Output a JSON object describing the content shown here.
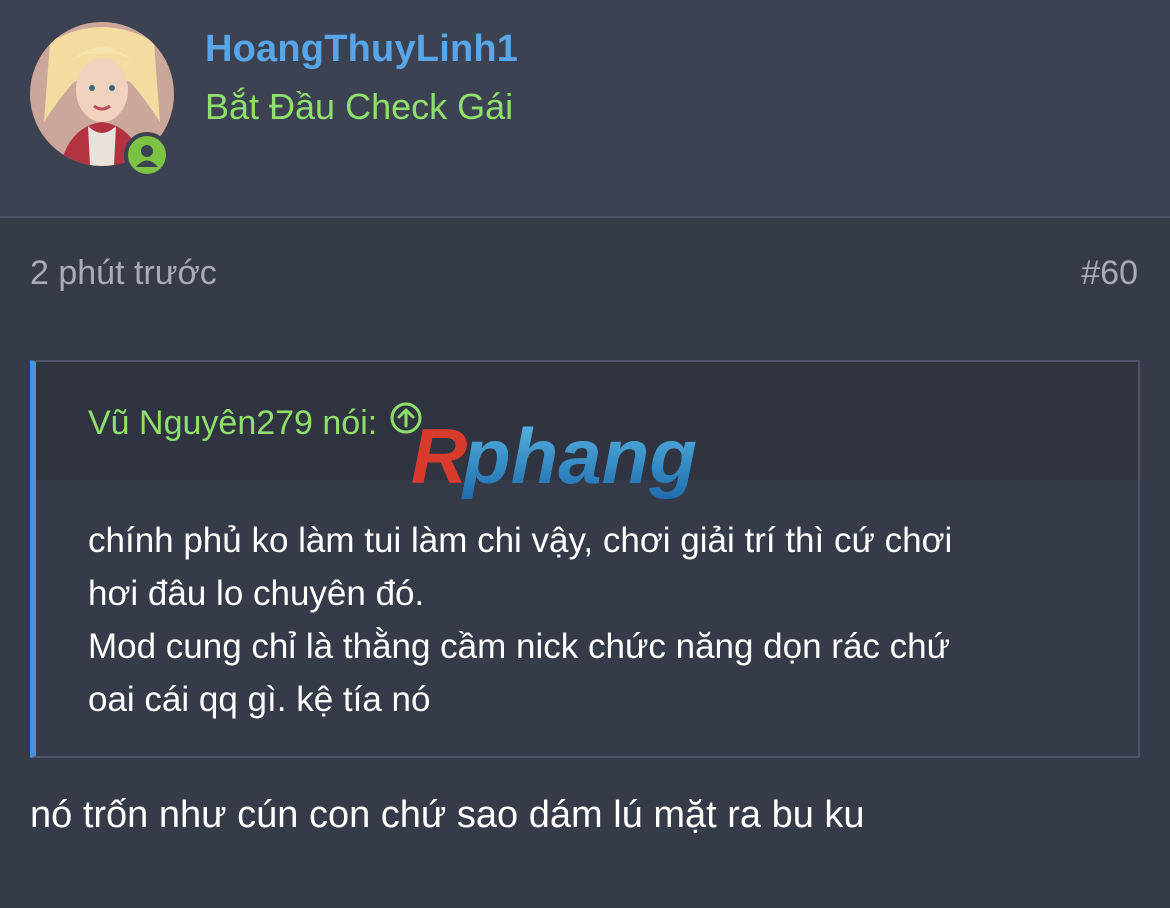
{
  "user": {
    "name": "HoangThuyLinh1",
    "title": "Bắt Đầu Check Gái"
  },
  "post": {
    "time": "2 phút trước",
    "number": "#60",
    "reply": "nó trốn như cún con chứ sao dám lú mặt ra bu ku"
  },
  "quote": {
    "author": "Vũ Nguyên279 nói:",
    "lines": [
      "chính phủ ko làm tui làm chi vậy, chơi giải trí thì cứ chơi",
      "hơi đâu lo chuyên đó.",
      "Mod cung chỉ là thằng cầm nick chức năng dọn rác chứ",
      "oai cái qq gì. kệ tía nó"
    ]
  },
  "watermark": {
    "text": "Rphang"
  },
  "colors": {
    "username": "#58a6e8",
    "title": "#8ee06a",
    "online": "#7cc243",
    "quote_bar": "#4a8fe0"
  }
}
